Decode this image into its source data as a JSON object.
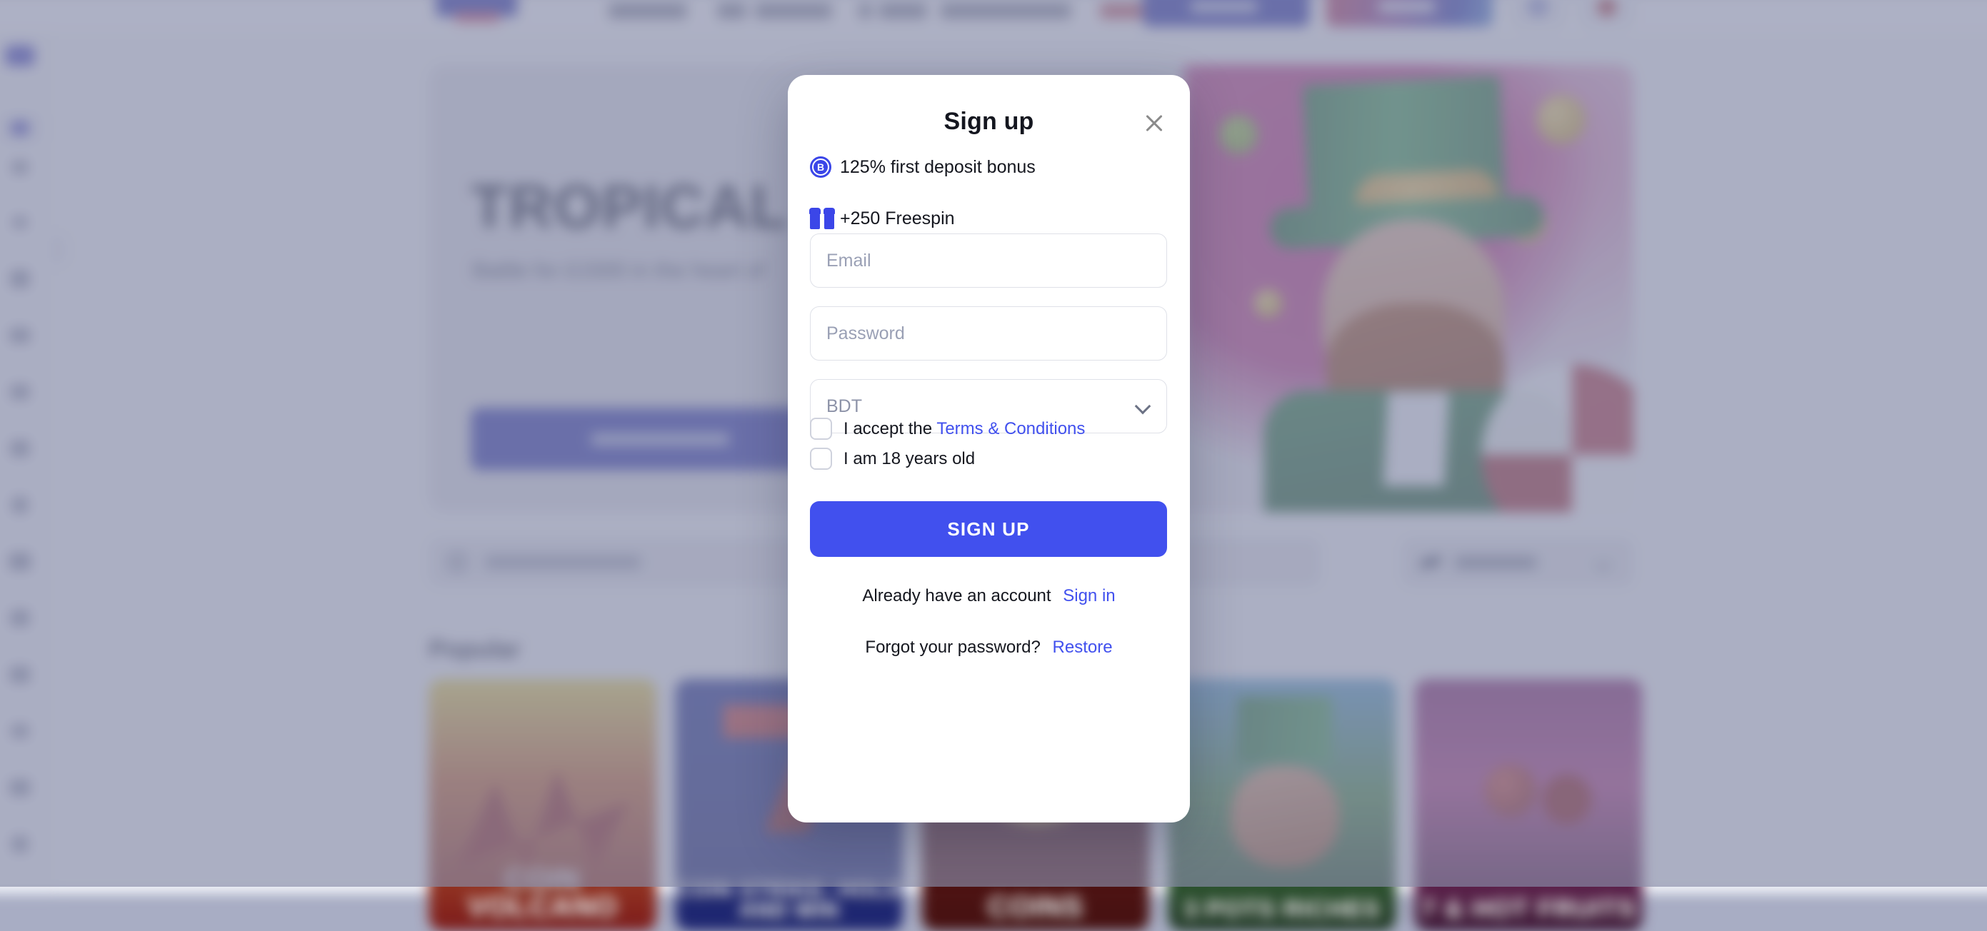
{
  "modal": {
    "title": "Sign up",
    "close_icon": "close-icon",
    "bonuses": [
      {
        "icon": "bonus-badge-icon",
        "icon_letter": "B",
        "text": "125% first deposit bonus"
      },
      {
        "icon": "gift-icon",
        "text": "+250 Freespin"
      }
    ],
    "fields": {
      "email_placeholder": "Email",
      "email_value": "",
      "password_placeholder": "Password",
      "password_value": "",
      "currency_value": "BDT",
      "currency_chevron": "chevron-down-icon"
    },
    "checkboxes": [
      {
        "prefix": "I accept the",
        "link": "Terms & Conditions",
        "checked": false
      },
      {
        "prefix": "I am 18 years old",
        "link": "",
        "checked": false
      }
    ],
    "submit_label": "SIGN UP",
    "footer": {
      "have_account_text": "Already have an account",
      "sign_in_link": "Sign in",
      "forgot_text": "Forgot your password?",
      "restore_link": "Restore"
    },
    "colors": {
      "accent": "#4150ee",
      "link": "#4150ee",
      "surface": "#ffffff",
      "text": "#15171f",
      "placeholder": "#9aa0b5",
      "border": "#dfe1e8"
    }
  },
  "background": {
    "header": {
      "logo": "site-logo",
      "nav_items": [
        "Casino",
        "Live casino",
        "Sports",
        "Tournaments",
        "Bonus"
      ],
      "sign_in_label": "Sign in",
      "sign_up_label": "Sign up",
      "search_icon": "search-icon",
      "language_icon": "language-icon"
    },
    "sidebar": {
      "items": [
        "sidebar-item-brand",
        "sidebar-item-home",
        "sidebar-item-casino",
        "sidebar-item-favorites",
        "sidebar-item-promotions",
        "sidebar-item-wallet",
        "sidebar-item-live",
        "sidebar-item-slots",
        "sidebar-item-tournaments",
        "sidebar-item-history",
        "sidebar-item-sports",
        "sidebar-item-tv-games",
        "sidebar-item-support",
        "sidebar-item-settings",
        "sidebar-item-more"
      ],
      "expand_icon": "chevron-right-icon"
    },
    "hero": {
      "title": "TROPICAL",
      "subtitle": "Battle for £1500 in the heart of",
      "cta_label": "Participate",
      "art": "leprechaun-artwork"
    },
    "search": {
      "placeholder": "Type game name",
      "icon": "search-icon"
    },
    "filter": {
      "label": "Gaming",
      "icon": "filter-icon",
      "chevron": "chevron-down-icon"
    },
    "popular": {
      "heading": "Popular",
      "games": [
        {
          "title": "COIN VOLCANO"
        },
        {
          "title": "COIN STRIKE: HOLD AND WIN"
        },
        {
          "title": "COINS"
        },
        {
          "title": "3 POTS RICHES"
        },
        {
          "title": "7 & HOT FRUITS"
        }
      ]
    }
  }
}
